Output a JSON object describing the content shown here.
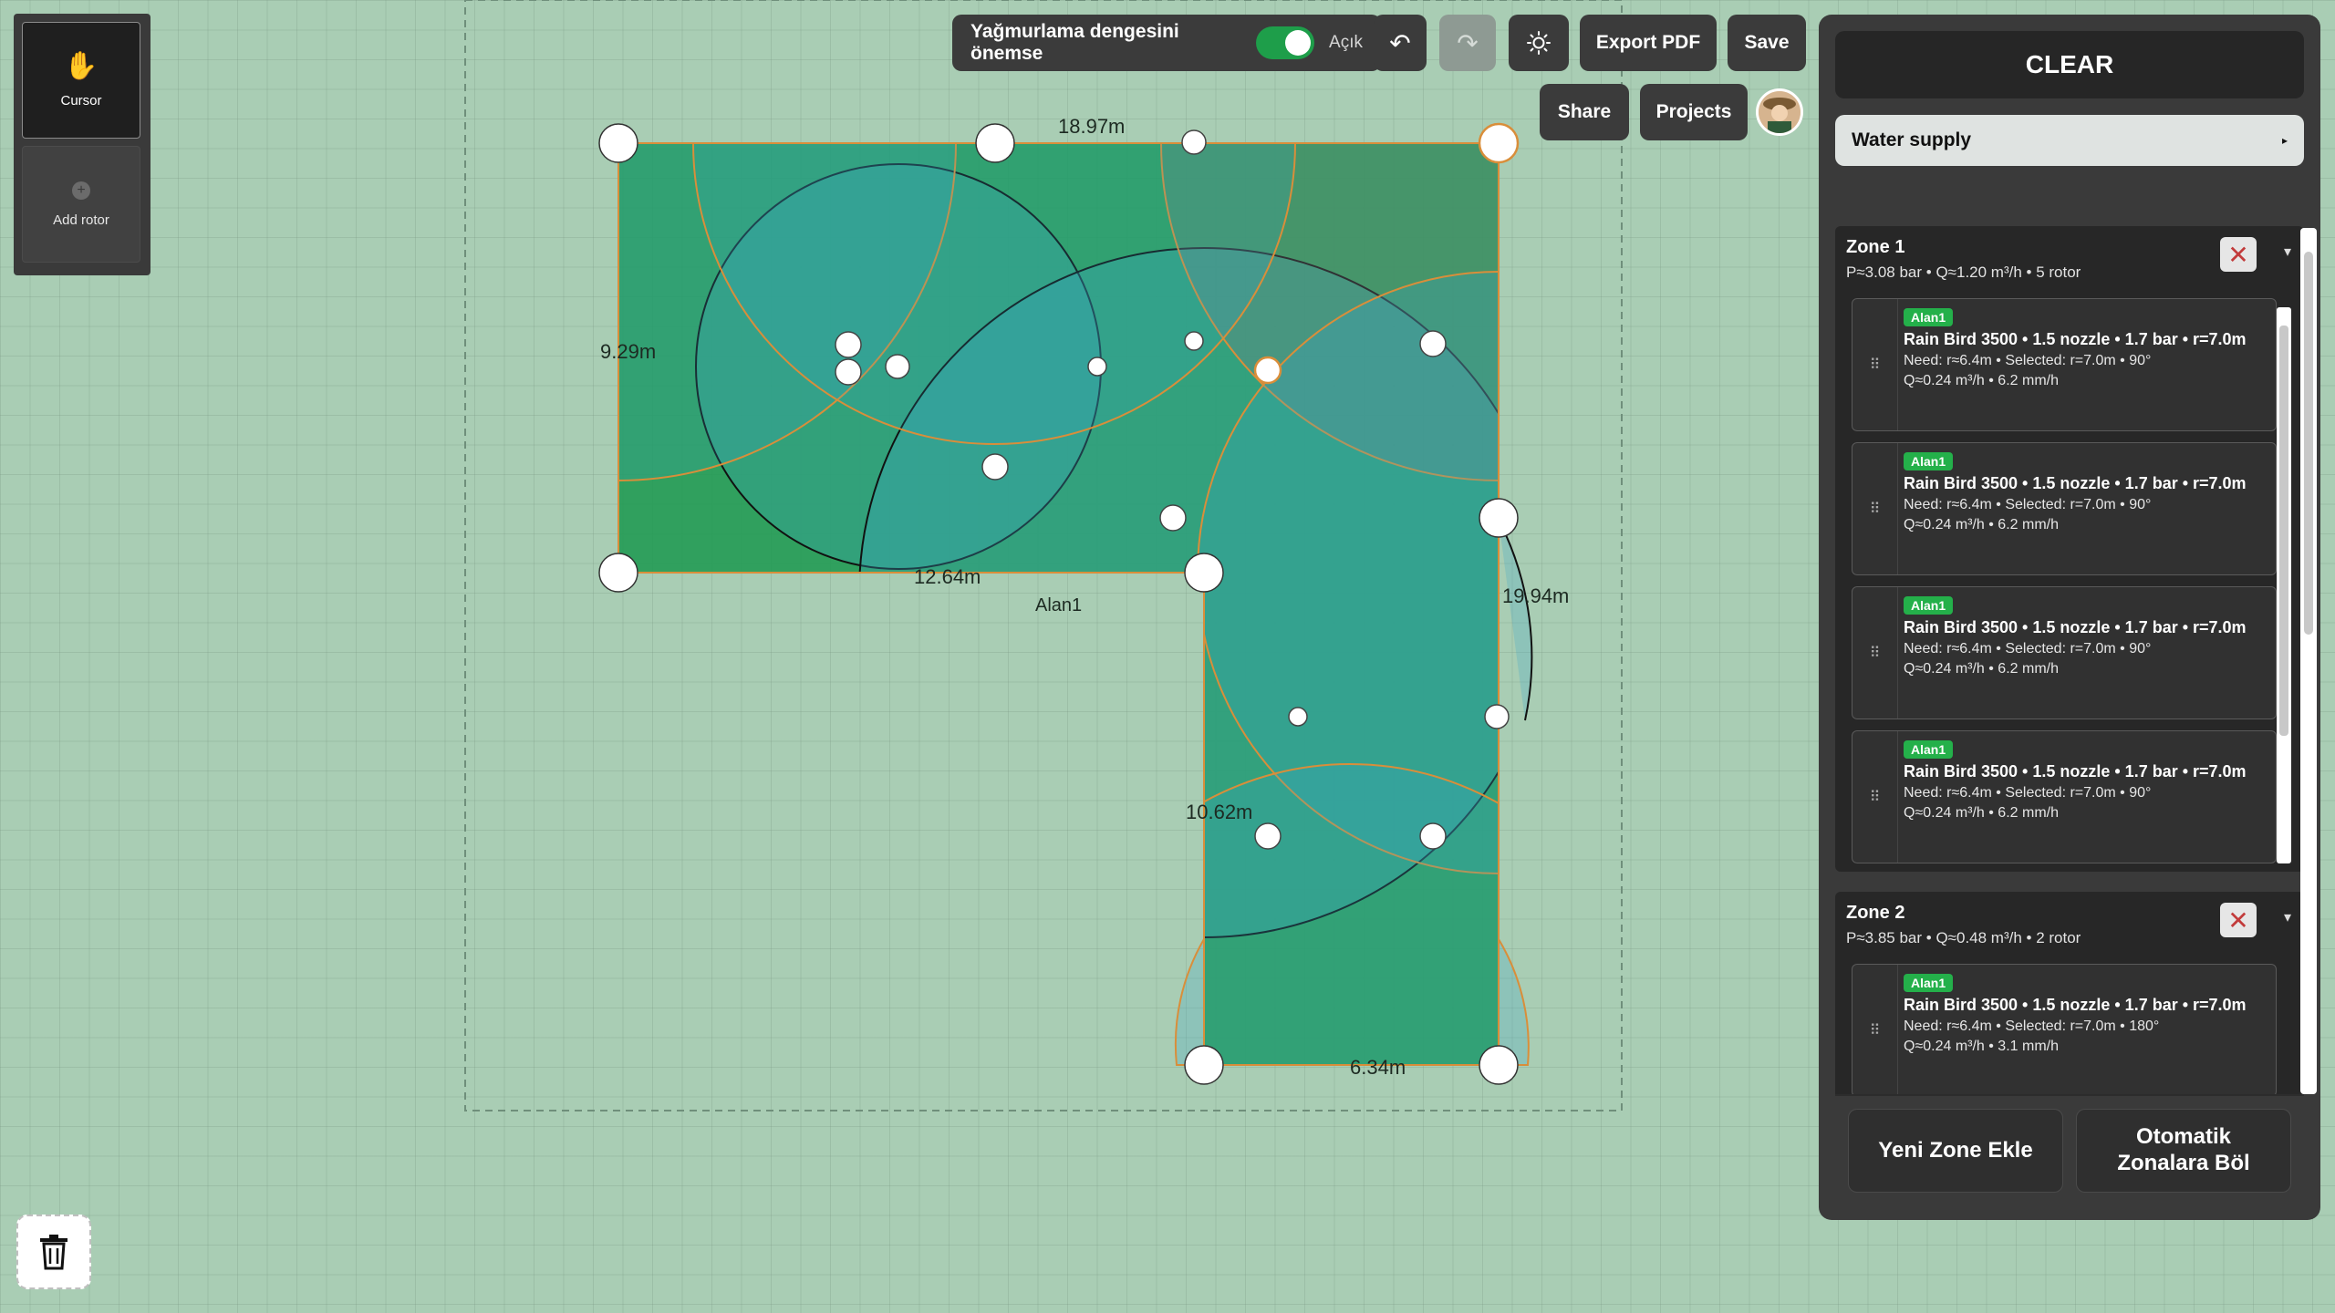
{
  "tools": {
    "cursor_label": "Cursor",
    "add_rotor_label": "Add rotor"
  },
  "toolbar": {
    "balance_label": "Yağmurlama dengesini önemse",
    "balance_state": "Açık",
    "balance_on": true,
    "undo_icon": "↶",
    "redo_icon": "↷",
    "export_label": "Export PDF",
    "save_label": "Save",
    "share_label": "Share",
    "projects_label": "Projects"
  },
  "canvas": {
    "area_label": "Alan1",
    "dim_top": "18.97m",
    "dim_left": "9.29m",
    "dim_mid": "12.64m",
    "dim_right": "19.94m",
    "dim_inner": "10.62m",
    "dim_bottom": "6.34m",
    "colors": {
      "lawn": "#1f9a52",
      "spray": "#3aa6c6",
      "edge": "#d98e3a"
    }
  },
  "panel": {
    "clear_label": "CLEAR",
    "water_supply_label": "Water supply",
    "water_supply_arrow": "▸",
    "zones": [
      {
        "title": "Zone 1",
        "meta": "P≈3.08 bar • Q≈1.20 m³/h • 5 rotor",
        "rotors": [
          {
            "tag": "Alan1",
            "title": "Rain Bird 3500 • 1.5 nozzle • 1.7 bar • r=7.0m",
            "need": "Need: r≈6.4m • Selected: r=7.0m • 90°",
            "q": "Q≈0.24 m³/h • 6.2 mm/h"
          },
          {
            "tag": "Alan1",
            "title": "Rain Bird 3500 • 1.5 nozzle • 1.7 bar • r=7.0m",
            "need": "Need: r≈6.4m • Selected: r=7.0m • 90°",
            "q": "Q≈0.24 m³/h • 6.2 mm/h"
          },
          {
            "tag": "Alan1",
            "title": "Rain Bird 3500 • 1.5 nozzle • 1.7 bar • r=7.0m",
            "need": "Need: r≈6.4m • Selected: r=7.0m • 90°",
            "q": "Q≈0.24 m³/h • 6.2 mm/h"
          },
          {
            "tag": "Alan1",
            "title": "Rain Bird 3500 • 1.5 nozzle • 1.7 bar • r=7.0m",
            "need": "Need: r≈6.4m • Selected: r=7.0m • 90°",
            "q": "Q≈0.24 m³/h • 6.2 mm/h"
          }
        ]
      },
      {
        "title": "Zone 2",
        "meta": "P≈3.85 bar • Q≈0.48 m³/h • 2 rotor",
        "rotors": [
          {
            "tag": "Alan1",
            "title": "Rain Bird 3500 • 1.5 nozzle • 1.7 bar • r=7.0m",
            "need": "Need: r≈6.4m • Selected: r=7.0m • 180°",
            "q": "Q≈0.24 m³/h • 3.1 mm/h"
          }
        ]
      }
    ],
    "new_zone_label": "Yeni Zone Ekle",
    "auto_zone_label_line1": "Otomatik",
    "auto_zone_label_line2": "Zonalara Böl"
  }
}
